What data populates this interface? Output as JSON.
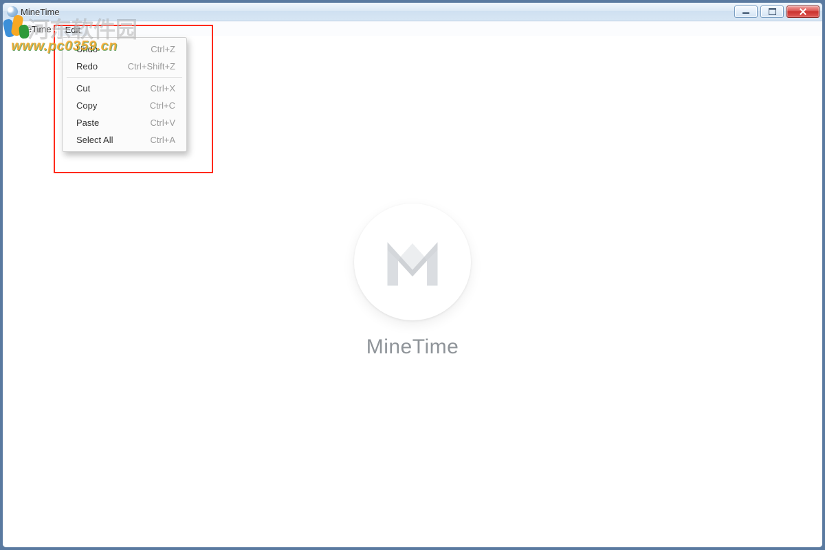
{
  "window": {
    "title": "MineTime"
  },
  "menubar": {
    "items": [
      {
        "label": "MineTime",
        "open": false
      },
      {
        "label": "Edit",
        "open": true
      }
    ]
  },
  "edit_menu": {
    "groups": [
      [
        {
          "label": "Undo",
          "accel": "Ctrl+Z"
        },
        {
          "label": "Redo",
          "accel": "Ctrl+Shift+Z"
        }
      ],
      [
        {
          "label": "Cut",
          "accel": "Ctrl+X"
        },
        {
          "label": "Copy",
          "accel": "Ctrl+C"
        },
        {
          "label": "Paste",
          "accel": "Ctrl+V"
        },
        {
          "label": "Select All",
          "accel": "Ctrl+A"
        }
      ]
    ]
  },
  "content": {
    "app_name": "MineTime"
  },
  "watermark": {
    "site_cn": "河东软件园",
    "site_url": "www.pc0359.cn"
  }
}
